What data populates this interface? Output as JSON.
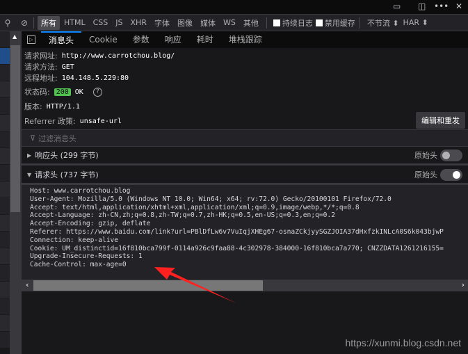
{
  "window_controls": [
    "dock-icon",
    "split-icon",
    "more-icon",
    "close-icon"
  ],
  "toolbar": {
    "filters": [
      "所有",
      "HTML",
      "CSS",
      "JS",
      "XHR",
      "字体",
      "图像",
      "媒体",
      "WS",
      "其他"
    ],
    "active_filter": "所有",
    "persist_logs": "持续日志",
    "disable_cache": "禁用缓存",
    "throttle": "不节流 ⬍",
    "har": "HAR ⬍"
  },
  "tabs": [
    "消息头",
    "Cookie",
    "参数",
    "响应",
    "耗时",
    "堆栈跟踪"
  ],
  "active_tab": "消息头",
  "summary": {
    "url_label": "请求网址:",
    "url": "http://www.carrotchou.blog/",
    "method_label": "请求方法:",
    "method": "GET",
    "remote_label": "远程地址:",
    "remote": "104.148.5.229:80",
    "status_label": "状态码:",
    "status_code": "200",
    "status_text": "OK",
    "version_label": "版本:",
    "version": "HTTP/1.1",
    "referrer_label": "Referrer 政策:",
    "referrer": "unsafe-url",
    "resend_button": "编辑和重发"
  },
  "filter_placeholder": "过滤消息头",
  "response_headers": {
    "title": "响应头 (299 字节)",
    "raw_label": "原始头",
    "raw_on": false
  },
  "request_headers": {
    "title": "请求头 (737 字节)",
    "raw_label": "原始头",
    "raw_on": true,
    "lines": [
      "Host: www.carrotchou.blog",
      "User-Agent: Mozilla/5.0 (Windows NT 10.0; Win64; x64; rv:72.0) Gecko/20100101 Firefox/72.0",
      "Accept: text/html,application/xhtml+xml,application/xml;q=0.9,image/webp,*/*;q=0.8",
      "Accept-Language: zh-CN,zh;q=0.8,zh-TW;q=0.7,zh-HK;q=0.5,en-US;q=0.3,en;q=0.2",
      "Accept-Encoding: gzip, deflate",
      "Referer: https://www.baidu.com/link?url=PBlDfLw6v7VuIqjXHEg67-osnaZCkjyySGZJOIA37dHxfzkINLcA0S6k043bjwP",
      "Connection: keep-alive",
      "Cookie: UM_distinctid=16f810bca799f-0114a926c9faa88-4c302978-384000-16f810bca7a770; CNZZDATA1261216155=",
      "Upgrade-Insecure-Requests: 1",
      "Cache-Control: max-age=0"
    ]
  },
  "colors": {
    "accent": "#0a84ff",
    "status_ok": "#51c251",
    "annotation_arrow": "#ff2020"
  },
  "watermark": "https://xunmi.blog.csdn.net"
}
